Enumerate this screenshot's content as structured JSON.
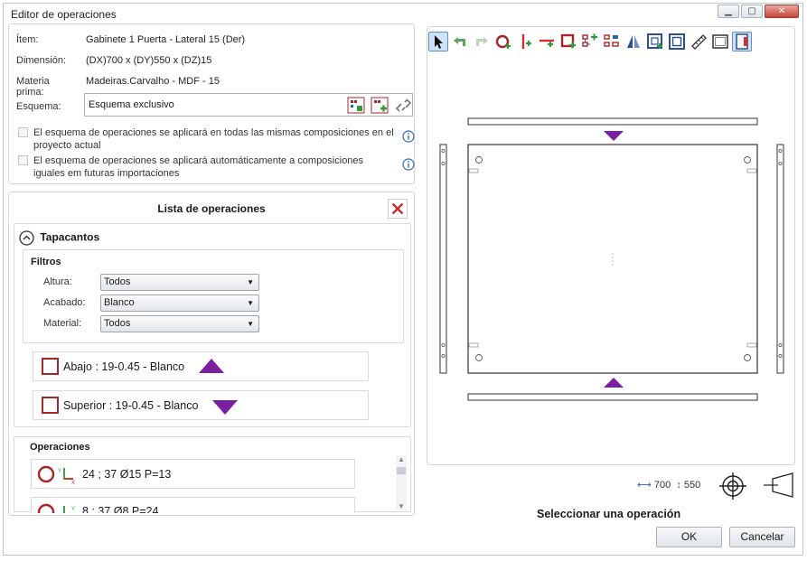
{
  "window": {
    "title": "Editor de operaciones",
    "controls": [
      "minimize",
      "maximize",
      "close"
    ]
  },
  "info": {
    "item_label": "Ítem:",
    "item_value": "Gabinete 1 Puerta - Lateral 15 (Der)",
    "dimension_label": "Dimensión:",
    "dimension_value": "(DX)700 x (DY)550 x (DZ)15",
    "material_label": "Materia prima:",
    "material_value": "Madeiras.Carvalho - MDF - 15",
    "schema_label": "Esquema:",
    "schema_value": "Esquema exclusivo",
    "check1": "El esquema de operaciones se aplicará en todas las mismas composiciones en el proyecto actual",
    "check2": "El esquema de operaciones se aplicará automáticamente a composiciones iguales em futuras importaciones"
  },
  "list": {
    "title": "Lista de operaciones",
    "section_edges": "Tapacantos",
    "filters_title": "Filtros",
    "filters": [
      {
        "label": "Altura:",
        "value": "Todos"
      },
      {
        "label": "Acabado:",
        "value": "Blanco"
      },
      {
        "label": "Material:",
        "value": "Todos"
      }
    ],
    "edges": [
      {
        "text": "Abajo : 19-0.45 - Blanco",
        "direction": "up"
      },
      {
        "text": "Superior : 19-0.45 - Blanco",
        "direction": "down"
      }
    ],
    "section_ops": "Operaciones",
    "operations": [
      {
        "text": "24 ; 37 Ø15 P=13"
      },
      {
        "text": "8 ; 37 Ø8 P=24"
      }
    ]
  },
  "canvas": {
    "dim_x": "700",
    "dim_y": "550",
    "status": "Seleccionar una operación"
  },
  "buttons": {
    "ok": "OK",
    "cancel": "Cancelar"
  },
  "colors": {
    "accent_purple": "#7b1fa2",
    "edge_red": "#a8262a",
    "toolbar_green": "#2e9a3a"
  }
}
